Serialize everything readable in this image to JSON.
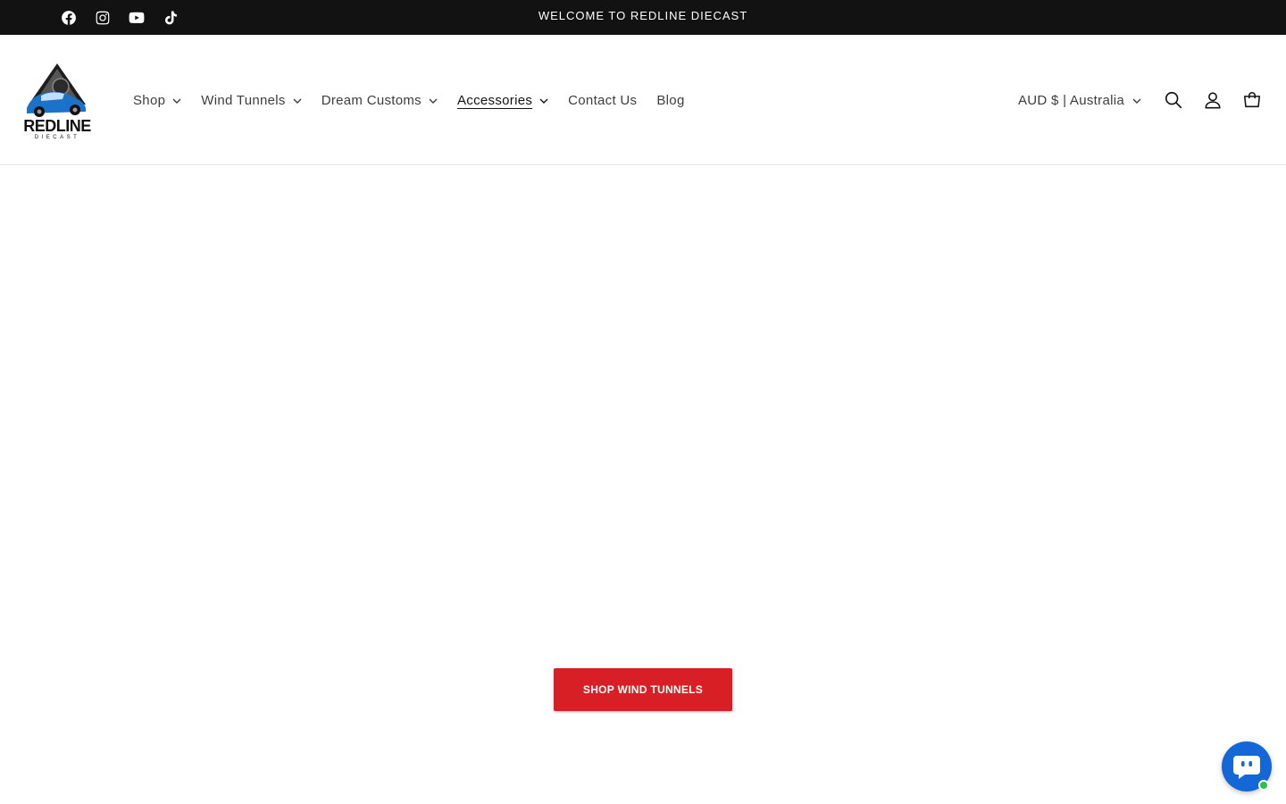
{
  "announcement": {
    "text": "WELCOME TO REDLINE DIECAST",
    "background": "#121212",
    "social_icons": [
      "facebook-icon",
      "instagram-icon",
      "youtube-icon",
      "tiktok-icon"
    ]
  },
  "header": {
    "logo_text": "REDLINE",
    "logo_subtext": "DIECAST",
    "nav": [
      {
        "label": "Shop",
        "has_dropdown": true
      },
      {
        "label": "Wind Tunnels",
        "has_dropdown": true
      },
      {
        "label": "Dream Customs",
        "has_dropdown": true
      },
      {
        "label": "Accessories",
        "has_dropdown": true,
        "active": true
      },
      {
        "label": "Contact Us",
        "has_dropdown": false
      },
      {
        "label": "Blog",
        "has_dropdown": false
      }
    ],
    "locale": "AUD $ | Australia",
    "icons": [
      "search-icon",
      "account-icon",
      "cart-icon"
    ]
  },
  "hero": {
    "cta_label": "SHOP WIND TUNNELS",
    "cta_color": "#d81f26"
  },
  "chat": {
    "icon": "chat-bubble-icon",
    "color": "#1467d6",
    "status_color": "#27c24c"
  }
}
